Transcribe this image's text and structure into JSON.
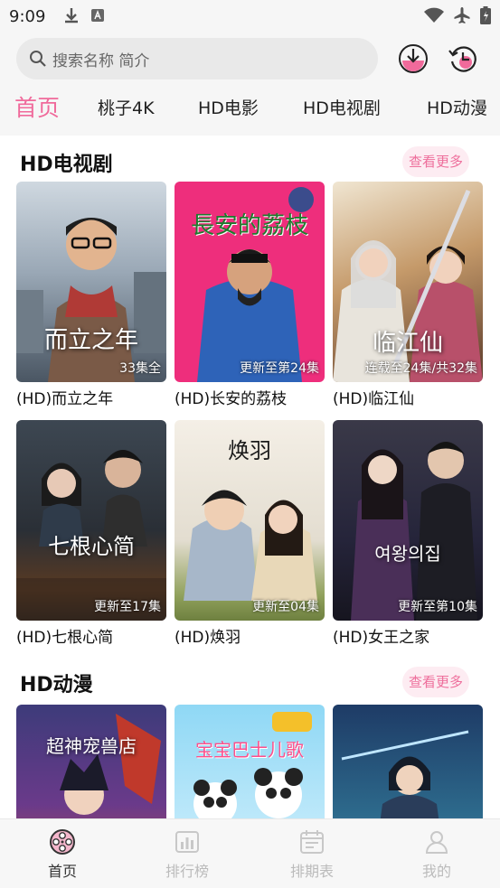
{
  "status_bar": {
    "time": "9:09"
  },
  "search": {
    "placeholder": "搜索名称 简介"
  },
  "tabs": [
    {
      "label": "首页",
      "active": true
    },
    {
      "label": "桃子4K",
      "active": false
    },
    {
      "label": "HD电影",
      "active": false
    },
    {
      "label": "HD电视剧",
      "active": false
    },
    {
      "label": "HD动漫",
      "active": false
    }
  ],
  "sections": [
    {
      "title": "HD电视剧",
      "more_label": "查看更多",
      "items": [
        {
          "caption": "(HD)而立之年",
          "badge": "33集全",
          "poster_text": "而立之年"
        },
        {
          "caption": "(HD)长安的荔枝",
          "badge": "更新至第24集",
          "poster_text": "長安的荔枝"
        },
        {
          "caption": "(HD)临江仙",
          "badge": "连载至24集/共32集",
          "poster_text": "临江仙"
        },
        {
          "caption": "(HD)七根心简",
          "badge": "更新至17集",
          "poster_text": "七根心简"
        },
        {
          "caption": "(HD)焕羽",
          "badge": "更新至04集",
          "poster_text": "焕羽"
        },
        {
          "caption": "(HD)女王之家",
          "badge": "更新至第10集",
          "poster_text": "여왕의집"
        }
      ]
    },
    {
      "title": "HD动漫",
      "more_label": "查看更多",
      "items": [
        {
          "poster_text": "超神宠兽店"
        },
        {
          "poster_text": "宝宝巴士儿歌"
        },
        {
          "poster_text": ""
        }
      ]
    }
  ],
  "bottom_nav": [
    {
      "label": "首页",
      "icon": "film-reel-icon",
      "active": true
    },
    {
      "label": "排行榜",
      "icon": "chart-icon",
      "active": false
    },
    {
      "label": "排期表",
      "icon": "calendar-icon",
      "active": false
    },
    {
      "label": "我的",
      "icon": "person-icon",
      "active": false
    }
  ],
  "colors": {
    "accent": "#f06a9b",
    "more_bg": "#fdecf2",
    "search_bg": "#e9e9e9"
  }
}
